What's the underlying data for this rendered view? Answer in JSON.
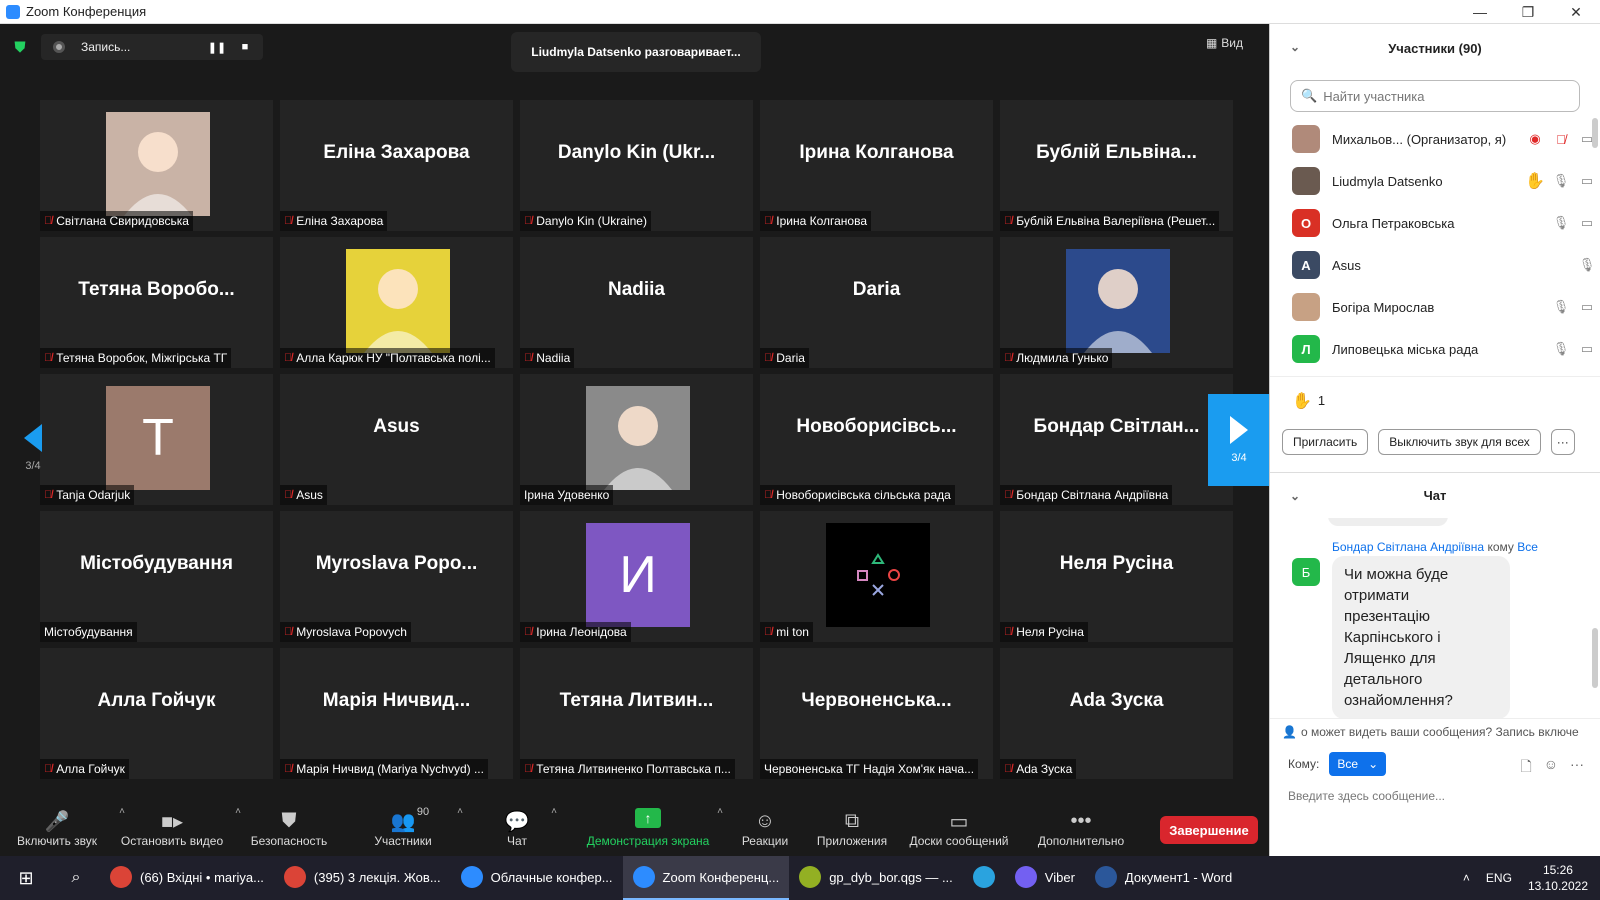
{
  "window": {
    "title": "Zoom Конференция",
    "min": "—",
    "restore": "❐",
    "close": "✕"
  },
  "topbar": {
    "rec_label": "Запись...",
    "pause": "❚❚",
    "stop": "■",
    "speaker": "Liudmyla Datsenko разговаривает...",
    "view": "Вид",
    "view_icon": "▦"
  },
  "nav": {
    "page": "3/4"
  },
  "tiles": [
    {
      "big": "",
      "label": "Світлана Свиридовська",
      "muted": true,
      "photo": "photo",
      "color": "#c9b3a6"
    },
    {
      "big": "Еліна Захарова",
      "label": "Еліна Захарова",
      "muted": true
    },
    {
      "big": "Danylo Kin (Ukr...",
      "label": "Danylo Kin (Ukraine)",
      "muted": true
    },
    {
      "big": "Ірина Колганова",
      "label": "Ірина Колганова",
      "muted": true
    },
    {
      "big": "Бублій Ельвіна...",
      "label": "Бублій Ельвіна Валеріївна (Решет...",
      "muted": true
    },
    {
      "big": "Тетяна Воробо...",
      "label": "Тетяна Воробок, Міжгірська ТГ",
      "muted": true
    },
    {
      "big": "",
      "label": "Алла Карюк НУ \"Полтавська полі...",
      "muted": true,
      "photo": "photo",
      "color": "#e6d23a"
    },
    {
      "big": "Nadiia",
      "label": "Nadiia",
      "muted": true
    },
    {
      "big": "Daria",
      "label": "Daria",
      "muted": true
    },
    {
      "big": "",
      "label": "Людмила Гунько",
      "muted": true,
      "photo": "photo",
      "color": "#2c4a8c"
    },
    {
      "big": "",
      "label": "Tanja Odarjuk",
      "muted": true,
      "photo": "letter",
      "letter": "T",
      "color": "#9b7a6c"
    },
    {
      "big": "Asus",
      "label": "Asus",
      "muted": true
    },
    {
      "big": "",
      "label": "Ірина Удовенко",
      "muted": false,
      "photo": "photo",
      "color": "#8a8a8a"
    },
    {
      "big": "Новоборисівсь...",
      "label": "Новоборисівська сільська рада",
      "muted": true
    },
    {
      "big": "Бондар Світлан...",
      "label": "Бондар Світлана Андріївна",
      "muted": true
    },
    {
      "big": "Містобудування",
      "label": "Містобудування",
      "muted": false
    },
    {
      "big": "Myroslava Popo...",
      "label": "Myroslava Popovych",
      "muted": true
    },
    {
      "big": "",
      "label": "Ірина Леонідова",
      "muted": true,
      "photo": "letter",
      "letter": "И",
      "color": "#7e57c2"
    },
    {
      "big": "",
      "label": "mi ton",
      "muted": true,
      "photo": "playstation",
      "color": "#000000"
    },
    {
      "big": "Неля Русіна",
      "label": "Неля Русіна",
      "muted": true
    },
    {
      "big": "Алла Гойчук",
      "label": "Алла Гойчук",
      "muted": true
    },
    {
      "big": "Марія Ничвид...",
      "label": "Марія Ничвид (Mariya Nychvyd) ...",
      "muted": true
    },
    {
      "big": "Тетяна Литвин...",
      "label": "Тетяна Литвиненко Полтавська п...",
      "muted": true
    },
    {
      "big": "Червоненська...",
      "label": "Червоненська ТГ Надія Хом'як нача...",
      "muted": false
    },
    {
      "big": "Ada Зуска",
      "label": "Ada Зуска",
      "muted": true
    }
  ],
  "toolbar": {
    "audio": "Включить звук",
    "video": "Остановить видео",
    "security": "Безопасность",
    "participants": "Участники",
    "participants_count": "90",
    "chat": "Чат",
    "share": "Демонстрация экрана",
    "reactions": "Реакции",
    "apps": "Приложения",
    "whiteboards": "Доски сообщений",
    "more": "Дополнительно",
    "end": "Завершение"
  },
  "panel": {
    "title": "Участники (90)",
    "search_placeholder": "Найти участника",
    "participants": [
      {
        "name": "Михальов...  (Организатор, я)",
        "initial": "",
        "color": "#b08a7a",
        "icons": [
          "◉",
          "🎙̸",
          "▭"
        ]
      },
      {
        "name": "Liudmyla Datsenko",
        "initial": "",
        "color": "#6a5a50",
        "icons": [
          "✋",
          "🎙",
          "▭"
        ]
      },
      {
        "name": "Ольга Петраковська",
        "initial": "О",
        "color": "#d93025",
        "icons": [
          "🎙",
          "▭"
        ]
      },
      {
        "name": "Asus",
        "initial": "A",
        "color": "#3b4a63",
        "icons": [
          "🎙"
        ]
      },
      {
        "name": "Богіра Мирослав",
        "initial": "",
        "color": "#c7a184",
        "icons": [
          "🎙",
          "▭"
        ]
      },
      {
        "name": "Липовецька міська рада",
        "initial": "Л",
        "color": "#23b84a",
        "icons": [
          "🎙",
          "▭"
        ]
      }
    ],
    "raised_count": "1",
    "invite": "Пригласить",
    "mute_all": "Выключить звук для всех",
    "more": "···"
  },
  "chat": {
    "title": "Чат",
    "sender": "Бондар Світлана Андріївна",
    "to_word": "кому",
    "recipient": "Все",
    "sender_initial": "Б",
    "message": "Чи можна буде отримати презентацію Карпінського і Лященко для детального ознайомлення?",
    "notice": "о может видеть ваши сообщения? Запись включе",
    "to_label": "Кому:",
    "to_value": "Все",
    "input_placeholder": "Введите здесь сообщение..."
  },
  "taskbar": {
    "items": [
      {
        "label": "(66) Вхідні • mariya...",
        "icon_color": "#db4437",
        "active": false
      },
      {
        "label": "(395) 3 лекція. Жов...",
        "icon_color": "#db4437",
        "active": false
      },
      {
        "label": "Облачные конфер...",
        "icon_color": "#2d8cff",
        "active": false
      },
      {
        "label": "Zoom Конференц...",
        "icon_color": "#2d8cff",
        "active": true
      },
      {
        "label": "gp_dyb_bor.qgs — ...",
        "icon_color": "#93b023",
        "active": false
      },
      {
        "label": "",
        "icon_color": "#2aa3df",
        "active": false
      },
      {
        "label": "Viber",
        "icon_color": "#7360f2",
        "active": false
      },
      {
        "label": "Документ1 - Word",
        "icon_color": "#2b579a",
        "active": false
      }
    ],
    "lang": "ENG",
    "time": "15:26",
    "date": "13.10.2022"
  }
}
